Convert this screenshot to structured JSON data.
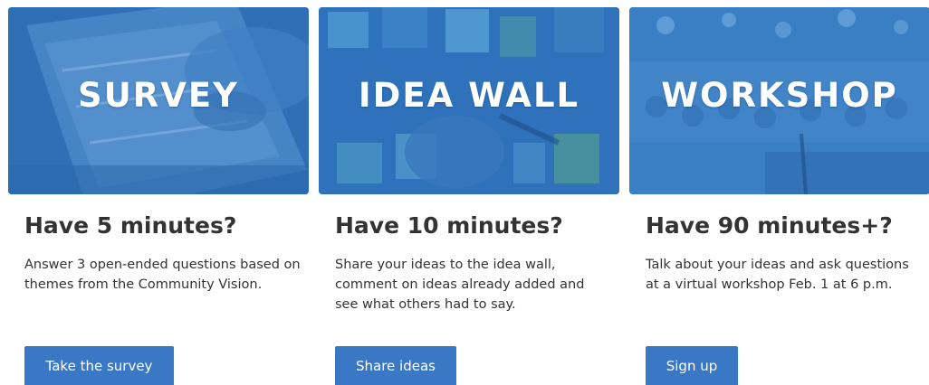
{
  "colors": {
    "banner_blue": "#2f74bd",
    "button_blue": "#3a78c6",
    "heading_text": "#333333",
    "banner_text": "#ffffff"
  },
  "cards": [
    {
      "banner_title": "SURVEY",
      "banner_image": "hand-writing-on-form-image",
      "heading": "Have 5 minutes?",
      "description": "Answer 3 open-ended questions based on themes from the Community Vision.",
      "button_label": "Take the survey"
    },
    {
      "banner_title": "IDEA WALL",
      "banner_image": "sticky-notes-wall-image",
      "heading": "Have 10 minutes?",
      "description": "Share your ideas to the idea wall, comment on ideas already added and see what others had to say.",
      "button_label": "Share ideas"
    },
    {
      "banner_title": "WORKSHOP",
      "banner_image": "audience-workshop-image",
      "heading": "Have 90 minutes+?",
      "description": "Talk about your ideas and ask questions at a virtual workshop Feb. 1 at 6 p.m.",
      "button_label": "Sign up"
    }
  ]
}
